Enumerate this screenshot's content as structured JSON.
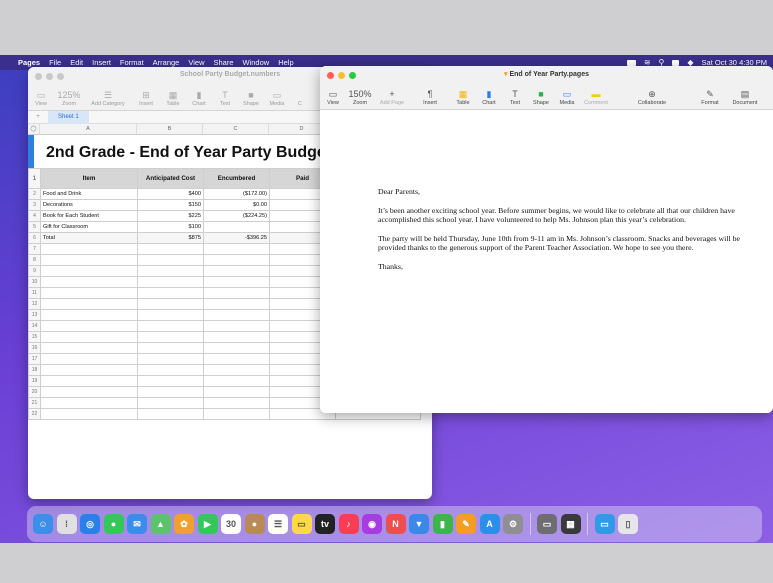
{
  "menubar": {
    "apple": "",
    "app_name": "Pages",
    "menus": [
      "File",
      "Edit",
      "Insert",
      "Format",
      "Arrange",
      "View",
      "Share",
      "Window",
      "Help"
    ],
    "clock": "Sat Oct 30  4:30 PM"
  },
  "numbers_window": {
    "title": "School Party Budget.numbers",
    "toolbar": [
      {
        "label": "View",
        "glyph": "▭"
      },
      {
        "label": "Zoom",
        "glyph": "125%"
      },
      {
        "label": "Add Category",
        "glyph": "☰"
      },
      {
        "label": "Insert",
        "glyph": "⊞"
      },
      {
        "label": "Table",
        "glyph": "▦"
      },
      {
        "label": "Chart",
        "glyph": "▮"
      },
      {
        "label": "Text",
        "glyph": "T"
      },
      {
        "label": "Shape",
        "glyph": "■"
      },
      {
        "label": "Media",
        "glyph": "▭"
      },
      {
        "label": "C",
        "glyph": ""
      }
    ],
    "sheet_tab": "Sheet 1",
    "columns": [
      "A",
      "B",
      "C",
      "D"
    ],
    "sheet_title": "2nd Grade - End of Year Party Budge",
    "headers": [
      "Item",
      "Anticipated Cost",
      "Encumbered",
      "Paid",
      ""
    ],
    "rows": [
      [
        "Food  and Drink",
        "$400",
        "($172.00)",
        "",
        ""
      ],
      [
        "Decorations",
        "$150",
        "$0.00",
        "($1",
        ""
      ],
      [
        "Book for Each Student",
        "$225",
        "($224.25)",
        "",
        ""
      ],
      [
        "Gift for Classroom",
        "$100",
        "",
        "",
        ""
      ],
      [
        "Total",
        "$875",
        "-$396.25",
        "-$",
        ""
      ]
    ],
    "row_numbers": [
      "1",
      "2",
      "3",
      "4",
      "5",
      "6",
      "7",
      "8",
      "9",
      "10",
      "11",
      "12",
      "13",
      "14",
      "15",
      "16",
      "17",
      "18",
      "19",
      "20",
      "21",
      "22"
    ]
  },
  "pages_window": {
    "title": "End of Year Party.pages",
    "toolbar": [
      {
        "label": "View",
        "glyph": "▭"
      },
      {
        "label": "Zoom",
        "glyph": "150%"
      },
      {
        "label": "Add Page",
        "glyph": "+"
      },
      {
        "label": "Insert",
        "glyph": "¶"
      },
      {
        "label": "Table",
        "glyph": "▦"
      },
      {
        "label": "Chart",
        "glyph": "▮"
      },
      {
        "label": "Text",
        "glyph": "T"
      },
      {
        "label": "Shape",
        "glyph": "■"
      },
      {
        "label": "Media",
        "glyph": "▭"
      },
      {
        "label": "Comment",
        "glyph": "▬"
      },
      {
        "label": "Collaborate",
        "glyph": "⊕"
      },
      {
        "label": "Format",
        "glyph": "✎"
      },
      {
        "label": "Document",
        "glyph": "▤"
      }
    ],
    "letter": {
      "salutation": "Dear Parents,",
      "p1": "It’s been another exciting school year. Before summer begins, we would like to celebrate all that our children have accomplished this school year. I have volunteered to help Ms. Johnson plan this year’s celebration.",
      "p2": "The party will be held Thursday, June 10th from 9-11 am in Ms. Johnson’s classroom. Snacks and beverages will be provided thanks to the generous support of the Parent Teacher Association. We hope to see you there.",
      "closing": "Thanks,"
    }
  },
  "dock": {
    "apps": [
      {
        "name": "finder-icon",
        "color": "#3b8eea",
        "glyph": "☺"
      },
      {
        "name": "launchpad-icon",
        "color": "#e0e0e0",
        "glyph": "⁞"
      },
      {
        "name": "safari-icon",
        "color": "#2a7fe8",
        "glyph": "◎"
      },
      {
        "name": "messages-icon",
        "color": "#34c759",
        "glyph": "●"
      },
      {
        "name": "mail-icon",
        "color": "#3a8dea",
        "glyph": "✉"
      },
      {
        "name": "maps-icon",
        "color": "#5bc36c",
        "glyph": "▲"
      },
      {
        "name": "photos-icon",
        "color": "#f0a030",
        "glyph": "✿"
      },
      {
        "name": "facetime-icon",
        "color": "#34c759",
        "glyph": "▶"
      },
      {
        "name": "calendar-icon",
        "color": "#ffffff",
        "glyph": "30"
      },
      {
        "name": "contacts-icon",
        "color": "#b98a55",
        "glyph": "●"
      },
      {
        "name": "reminders-icon",
        "color": "#ffffff",
        "glyph": "☰"
      },
      {
        "name": "notes-icon",
        "color": "#ffd84a",
        "glyph": "▭"
      },
      {
        "name": "tv-icon",
        "color": "#222222",
        "glyph": "tv"
      },
      {
        "name": "music-icon",
        "color": "#fa3c55",
        "glyph": "♪"
      },
      {
        "name": "podcasts-icon",
        "color": "#a63de0",
        "glyph": "◉"
      },
      {
        "name": "news-icon",
        "color": "#f04e4e",
        "glyph": "N"
      },
      {
        "name": "keynote-icon",
        "color": "#3b88e8",
        "glyph": "▼"
      },
      {
        "name": "numbers-icon",
        "color": "#3cb54a",
        "glyph": "▮"
      },
      {
        "name": "pages-icon",
        "color": "#f39c26",
        "glyph": "✎"
      },
      {
        "name": "app-store-icon",
        "color": "#2b8fea",
        "glyph": "A"
      },
      {
        "name": "system-preferences-icon",
        "color": "#8e8e93",
        "glyph": "⚙"
      }
    ],
    "utilities": [
      {
        "name": "screenshot-icon",
        "color": "#6d6d72",
        "glyph": "▭"
      },
      {
        "name": "calculator-icon",
        "color": "#3a3a3c",
        "glyph": "▦"
      }
    ],
    "trailing": [
      {
        "name": "downloads-folder-icon",
        "color": "#2f9ae8",
        "glyph": "▭"
      },
      {
        "name": "trash-icon",
        "color": "#e6e6ea",
        "glyph": "▯"
      }
    ]
  }
}
